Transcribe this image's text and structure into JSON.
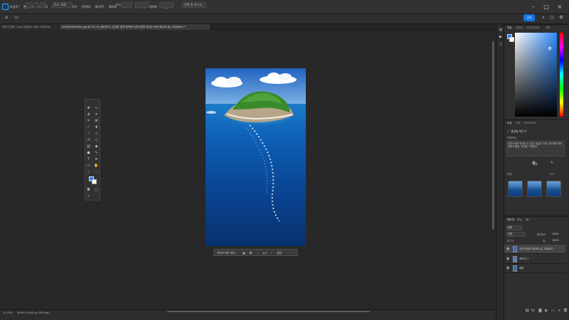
{
  "menubar": {
    "items": [
      "파일(F)",
      "편집(E)",
      "이미지(I)",
      "레이어(L)",
      "문자(Y)",
      "선택(S)",
      "필터(T)",
      "3D(D)",
      "보기(V)",
      "플러그인",
      "창(W)",
      "도움말(H)"
    ],
    "window_controls": [
      "–",
      "□",
      "×"
    ]
  },
  "options": {
    "mode_label": "모드: 표준",
    "opacity_label": "모드",
    "select_subject": "선택 및 마스크..."
  },
  "header": {
    "share_label": "공유",
    "tabs": [
      "레이어 없음 1.psd (배경색, 배경, RGB/8#)",
      "Ind0000000000.jpg @ 15.2% (레이어 0, 유연한 흰색 영역에 자연스럽게 섞이는 파란 바다와 섬), RGB/8#) *"
    ]
  },
  "context_bar": {
    "label": "자연스러운 바다...",
    "page": "1/3",
    "generate": "생성"
  },
  "status": {
    "zoom": "15.23%",
    "doc_info": "3456 x 6144 px (300 ppi)"
  },
  "color_panel": {
    "tabs": [
      "색상",
      "색견본",
      "그레이디언트",
      "패턴"
    ],
    "fg": "#2f7cf6",
    "bg": "#ffffff"
  },
  "properties_panel": {
    "tabs": [
      "속성",
      "조정",
      "라이브러리"
    ],
    "title": "생성형 채우기",
    "prompt_label": "프롬프트",
    "description": "자연스러운 바다와 섬, 맑은 하늘과 구름, 부드러운 파도, 청록색 물빛, 자연광, 고해상도",
    "generate_label": "생성",
    "variations_label": "변형",
    "variations_count": "1/3"
  },
  "layers_panel": {
    "tabs": [
      "레이어",
      "채널",
      "패스"
    ],
    "kind_label": "종류",
    "blend_mode": "표준",
    "opacity_label": "불투명도:",
    "opacity_value": "100%",
    "lock_label": "잠그기:",
    "fill_label": "칠:",
    "fill_value": "100%",
    "layers": [
      {
        "name": "자연스러운 바다와 섬, 고해상도",
        "selected": true
      },
      {
        "name": "레이어 1",
        "selected": false
      },
      {
        "name": "배경",
        "selected": false
      }
    ]
  }
}
